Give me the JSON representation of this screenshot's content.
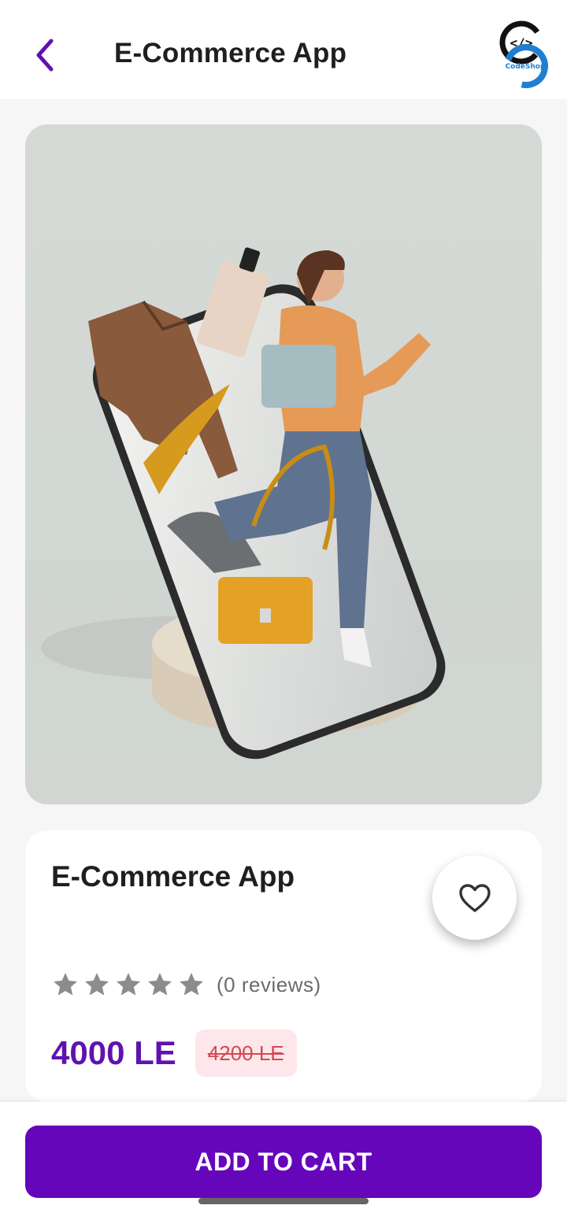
{
  "header": {
    "title": "E-Commerce App",
    "logo_text": "CodeShop",
    "back_icon": "chevron-left-icon"
  },
  "product": {
    "title": "E-Commerce App",
    "rating": 0,
    "rating_max": 5,
    "reviews_text": "(0 reviews)",
    "price": "4000 LE",
    "old_price": "4200 LE",
    "favorite_icon": "heart-outline-icon"
  },
  "actions": {
    "add_to_cart_label": "ADD TO CART"
  },
  "colors": {
    "accent": "#6606bb",
    "price": "#5f12b0",
    "old_price": "#d54853",
    "old_price_bg": "#fde7ea",
    "star": "#8c8c8c"
  }
}
